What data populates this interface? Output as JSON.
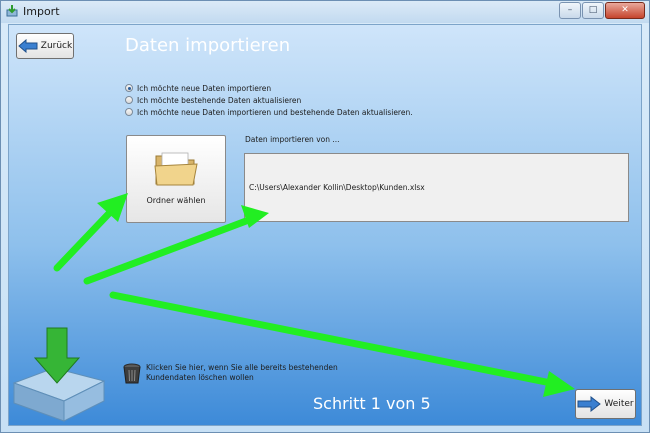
{
  "window": {
    "title": "Import",
    "buttons": {
      "minimize": "–",
      "maximize": "□",
      "close": "✕"
    }
  },
  "toolbar": {
    "back_label": "Zurück",
    "next_label": "Weiter"
  },
  "page": {
    "heading": "Daten importieren",
    "step": "Schritt 1 von 5"
  },
  "import_options": {
    "options": [
      {
        "label": "Ich möchte neue Daten importieren",
        "checked": true
      },
      {
        "label": "Ich möchte bestehende Daten aktualisieren",
        "checked": false
      },
      {
        "label": "Ich möchte neue Daten importieren und bestehende Daten aktualisieren.",
        "checked": false
      }
    ]
  },
  "source": {
    "folder_button_label": "Ordner wählen",
    "caption": "Daten importieren von ...",
    "path": "C:\\Users\\Alexander Kollin\\Desktop\\Kunden.xlsx"
  },
  "delete": {
    "text": "Klicken Sie hier, wenn Sie alle bereits bestehenden Kundendaten löschen wollen"
  },
  "colors": {
    "annotation_arrow": "#22ee22",
    "heading": "#ffffff",
    "gradient_bottom": "#3d8ad8"
  },
  "icons": [
    "app-icon",
    "back-arrow-icon",
    "folder-icon",
    "trash-icon",
    "import-tray-icon",
    "forward-arrow-icon"
  ]
}
